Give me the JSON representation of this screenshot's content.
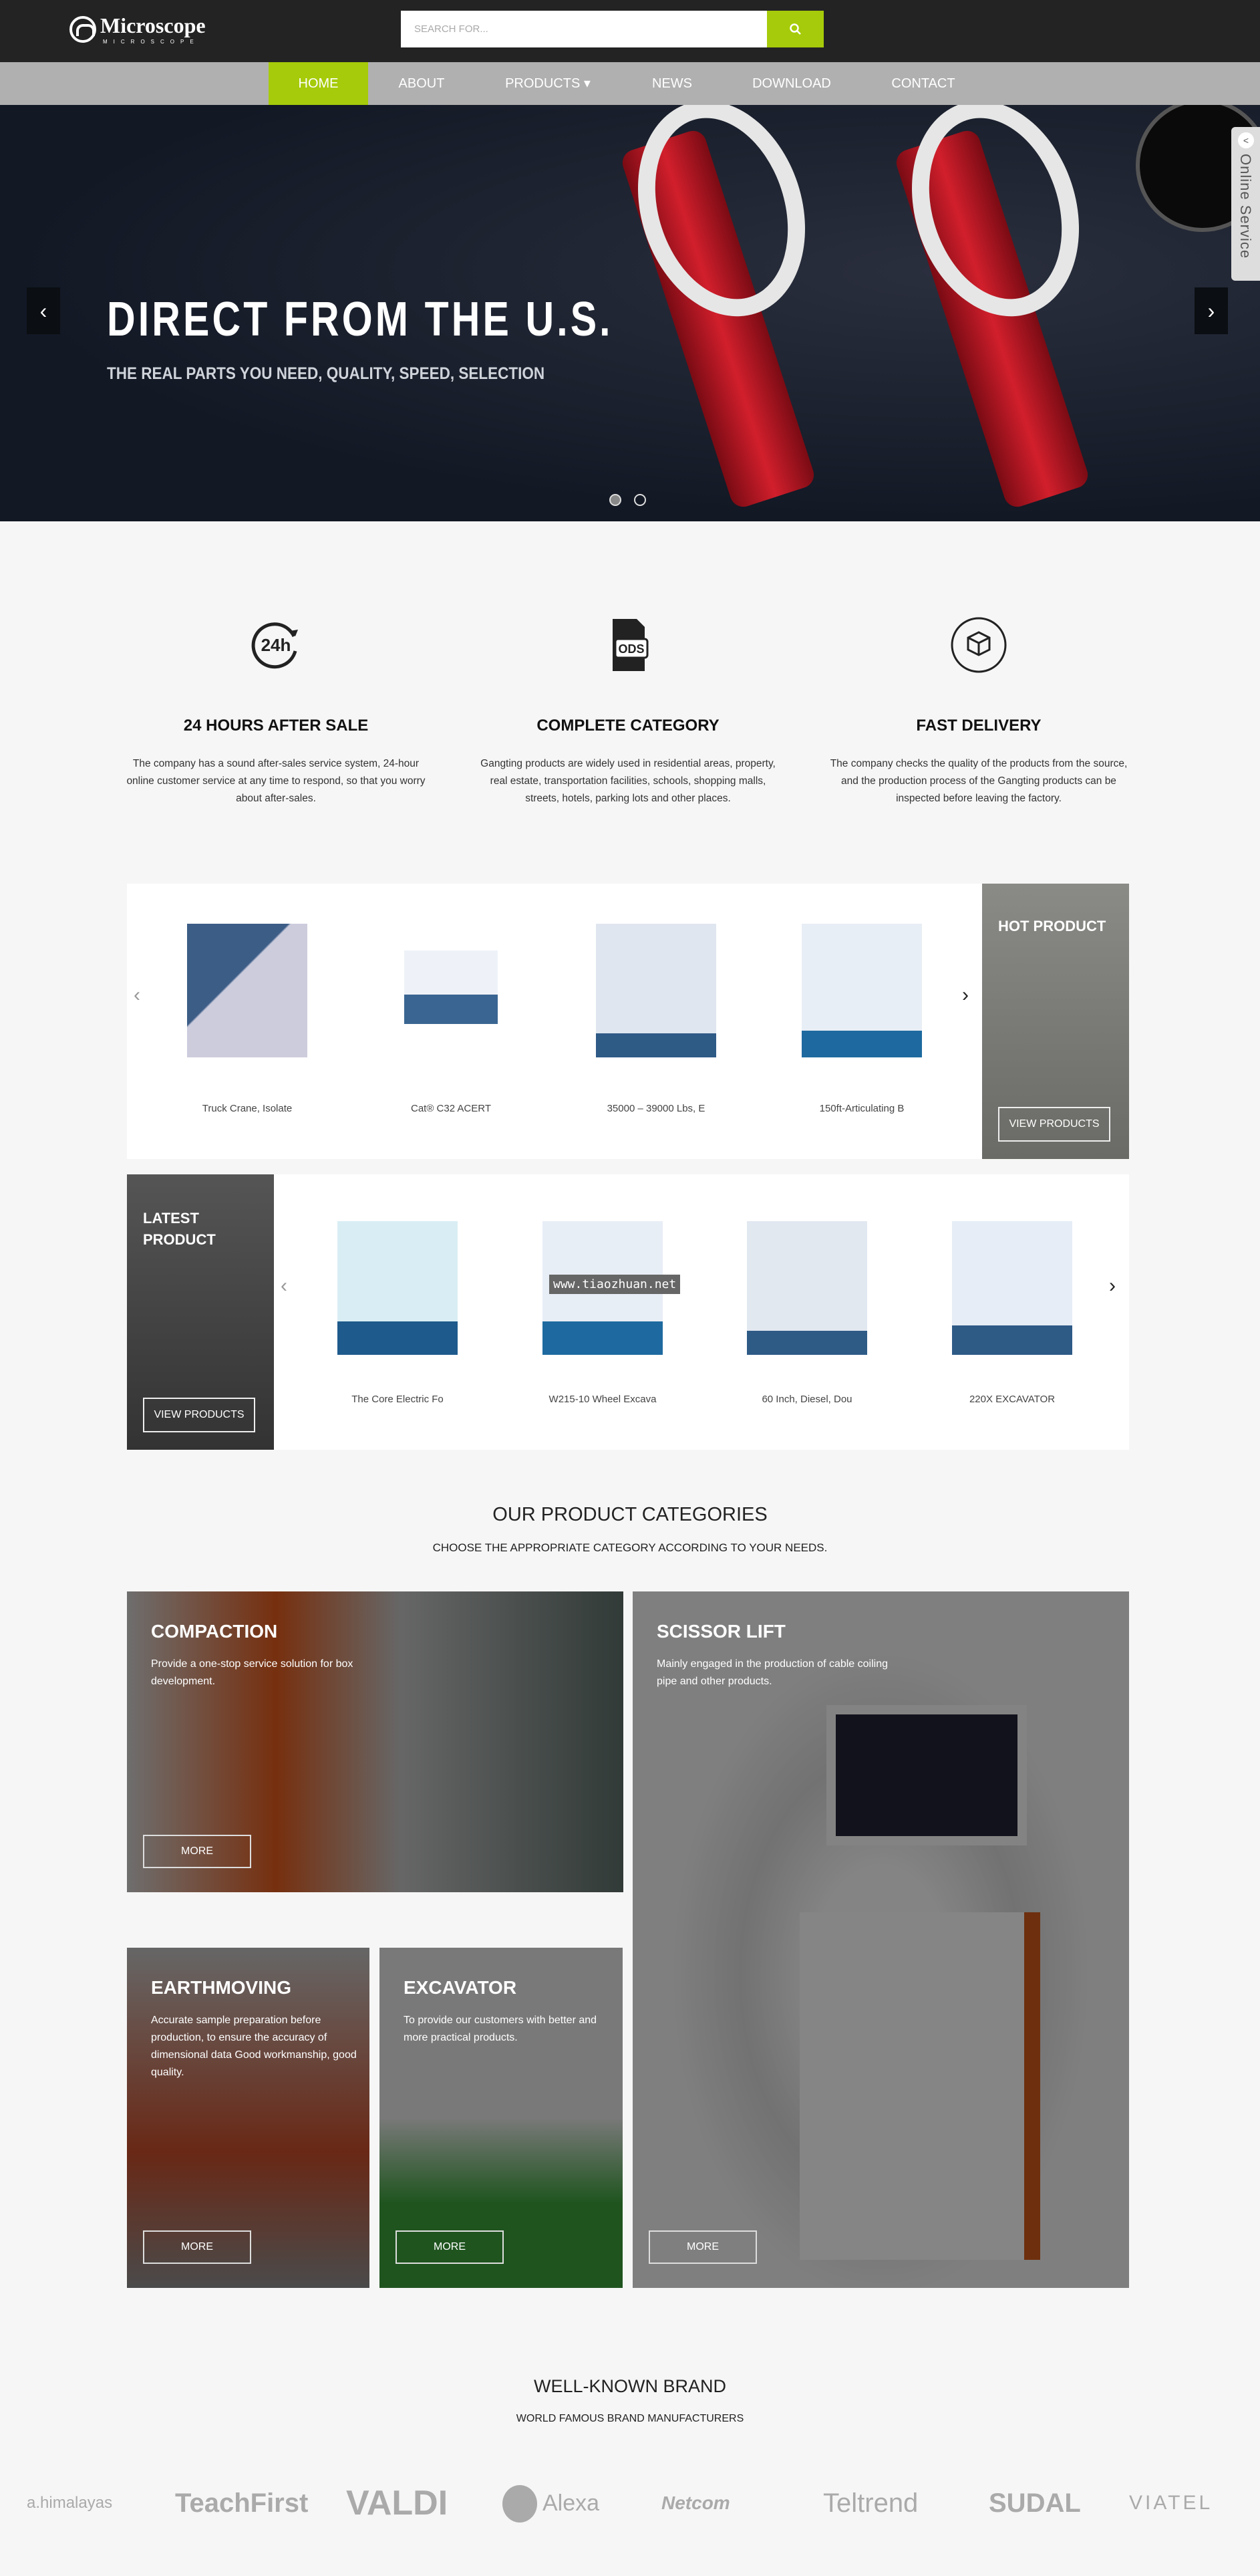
{
  "header": {
    "logo": "Microscope",
    "logo_sub": "MICROSCOPE",
    "search_placeholder": "SEARCH FOR...",
    "search_icon": "search-icon"
  },
  "nav": [
    {
      "label": "HOME",
      "active": true
    },
    {
      "label": "ABOUT"
    },
    {
      "label": "PRODUCTS ▾"
    },
    {
      "label": "NEWS"
    },
    {
      "label": "DOWNLOAD"
    },
    {
      "label": "CONTACT"
    }
  ],
  "accent": "#a6cb0a",
  "hero": {
    "title": "DIRECT FROM THE U.S.",
    "subtitle": "THE REAL PARTS YOU NEED, QUALITY, SPEED, SELECTION",
    "prev": "‹",
    "next": "›",
    "slides": 2,
    "active_slide": 1
  },
  "online_service": {
    "label": "Online Service",
    "toggle": "<"
  },
  "features": [
    {
      "icon": "24h-icon",
      "title": "24 HOURS AFTER SALE",
      "text": "The company has a sound after-sales service system, 24-hour online customer service at any time to respond, so that you worry about after-sales."
    },
    {
      "icon": "ods-file-icon",
      "title": "COMPLETE CATEGORY",
      "text": "Gangting products are widely used in residential areas, property, real estate, transportation facilities, schools, shopping malls, streets, hotels, parking lots and other places."
    },
    {
      "icon": "box-icon",
      "title": "FAST DELIVERY",
      "text": "The company checks the quality of the products from the source, and the production process of the Gangting products can be inspected before leaving the factory."
    }
  ],
  "hot": {
    "title": "HOT PRODUCT",
    "button": "VIEW PRODUCTS",
    "items": [
      "Truck Crane, Isolate",
      "Cat® C32 ACERT",
      "35000 – 39000 Lbs, E",
      "150ft-Articulating B"
    ]
  },
  "latest": {
    "title1": "LATEST",
    "title2": "PRODUCT",
    "button": "VIEW PRODUCTS",
    "watermark": "www.tiaozhuan.net",
    "items": [
      "The Core Electric Fo",
      "W215-10 Wheel Excava",
      "60 Inch, Diesel, Dou",
      "220X EXCAVATOR"
    ]
  },
  "categories": {
    "title": "OUR PRODUCT CATEGORIES",
    "subtitle": "CHOOSE THE APPROPRIATE CATEGORY ACCORDING TO YOUR NEEDS.",
    "more": "MORE",
    "items": [
      {
        "title": "COMPACTION",
        "text": "Provide a one-stop service solution for box development."
      },
      {
        "title": "SCISSOR LIFT",
        "text": "Mainly engaged in the production of cable coiling pipe and other products."
      },
      {
        "title": "EARTHMOVING",
        "text": "Accurate sample preparation before production, to ensure the accuracy of dimensional data Good workmanship, good quality."
      },
      {
        "title": "EXCAVATOR",
        "text": "To provide our customers with better and more practical products."
      }
    ]
  },
  "brands": {
    "title": "WELL-KNOWN BRAND",
    "subtitle": "WORLD FAMOUS BRAND MANUFACTURERS",
    "items": [
      "a.himalayas",
      "TeachFirst",
      "VALDI",
      "Alexa",
      "Netcom",
      "Teltrend",
      "SUDAL",
      "VIATEL"
    ]
  }
}
